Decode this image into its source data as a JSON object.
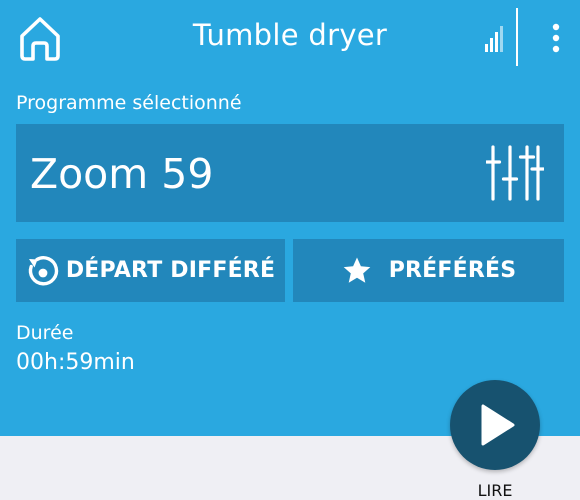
{
  "header": {
    "title": "Tumble dryer",
    "home_icon": "home-icon",
    "signal_icon": "signal-bars-icon",
    "menu_icon": "more-vertical-icon"
  },
  "program": {
    "section_label": "Programme sélectionné",
    "name": "Zoom 59",
    "settings_icon": "sliders-icon"
  },
  "actions": {
    "delay_label": "DÉPART DIFFÉRÉ",
    "delay_icon": "timer-restart-icon",
    "favorites_label": "PRÉFÉRÉS",
    "favorites_icon": "star-icon"
  },
  "duration": {
    "label": "Durée",
    "value": "00h:59min"
  },
  "play": {
    "label": "LIRE",
    "icon": "play-icon"
  },
  "colors": {
    "primary": "#2aa8e0",
    "panel": "#2287bb",
    "play_button": "#17526f",
    "background_bottom": "#efeff4"
  }
}
